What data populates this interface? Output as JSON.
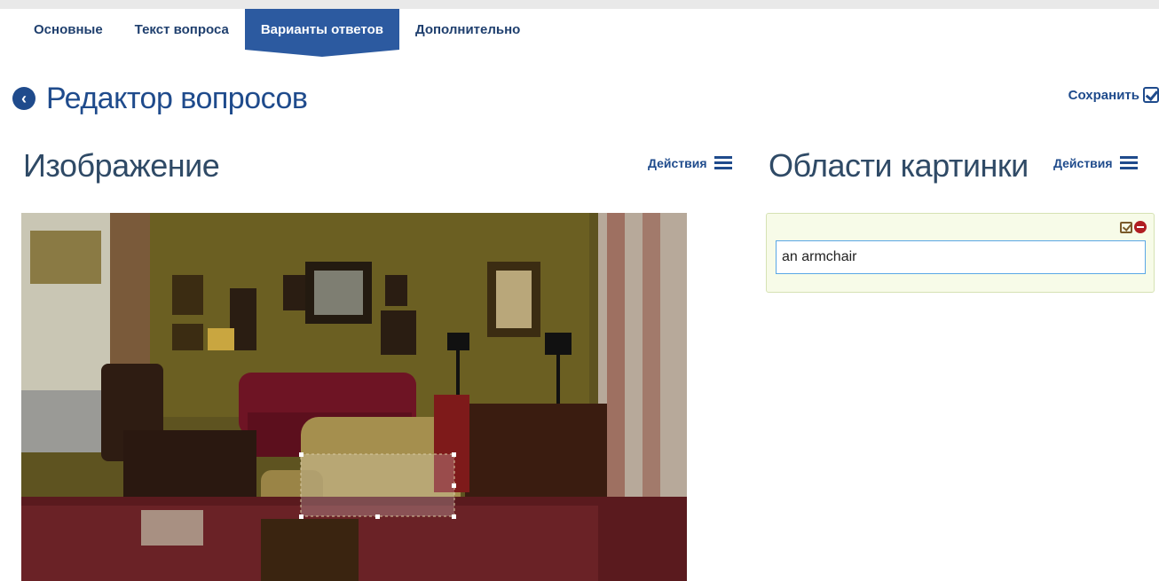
{
  "tabs": [
    {
      "label": "Основные",
      "active": false
    },
    {
      "label": "Текст вопроса",
      "active": false
    },
    {
      "label": "Варианты ответов",
      "active": true
    },
    {
      "label": "Дополнительно",
      "active": false
    }
  ],
  "header": {
    "title": "Редактор вопросов",
    "back_icon": "chevron-left-circle-icon",
    "save_label": "Сохранить",
    "save_icon": "check-square-icon"
  },
  "image_section": {
    "title": "Изображение",
    "actions_label": "Действия",
    "actions_icon": "hamburger-icon"
  },
  "regions_section": {
    "title": "Области картинки",
    "actions_label": "Действия",
    "actions_icon": "hamburger-icon",
    "regions": [
      {
        "value": "an armchair"
      }
    ]
  },
  "colors": {
    "accent": "#2c5aa0",
    "heading": "#1f4b8c",
    "card_bg": "#f7fbe8",
    "delete": "#b01e23"
  }
}
